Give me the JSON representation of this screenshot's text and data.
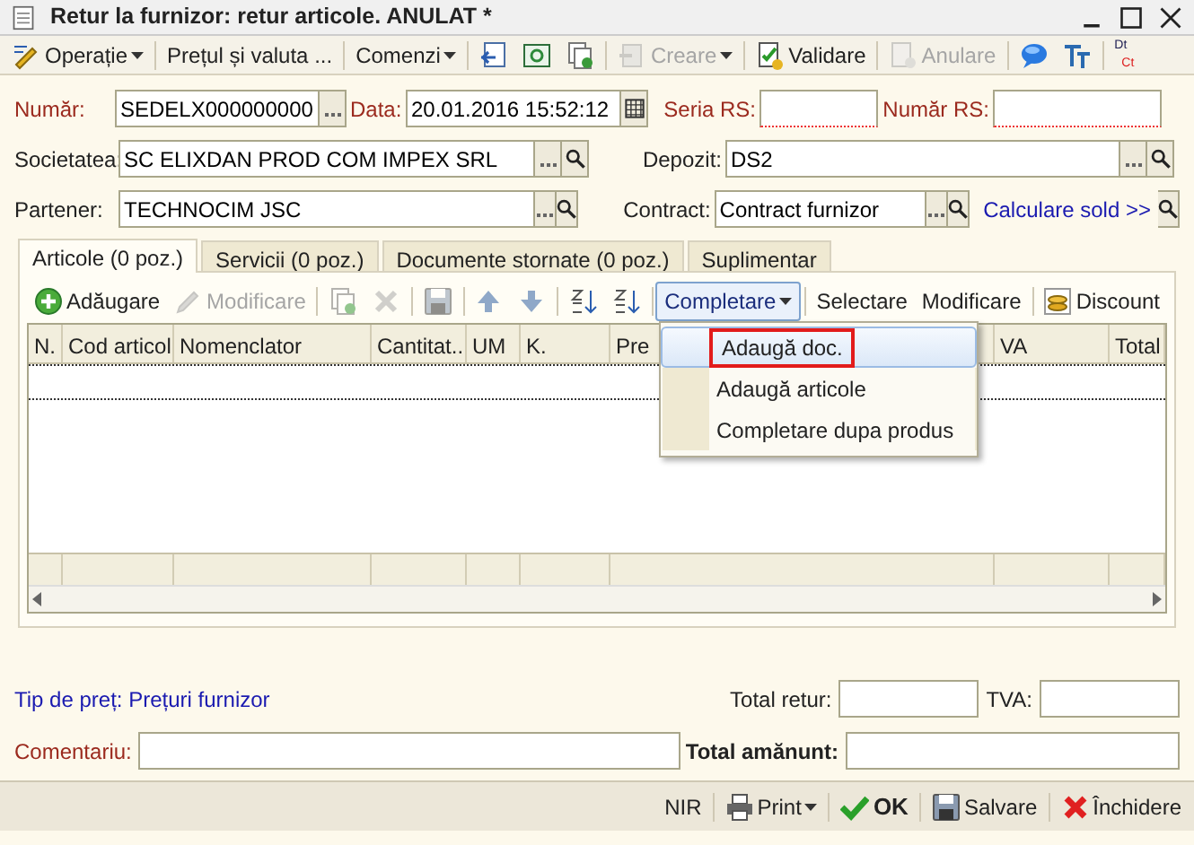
{
  "window": {
    "title": "Retur la furnizor: retur articole. ANULAT *"
  },
  "toolbar": [
    {
      "kind": "menu",
      "label": "Operație",
      "disabled": false
    },
    {
      "kind": "button",
      "label": "Prețul și valuta ...",
      "disabled": false
    },
    {
      "kind": "menu",
      "label": "Comenzi",
      "disabled": false
    },
    {
      "kind": "icon",
      "disabled": false
    },
    {
      "kind": "icon",
      "disabled": false
    },
    {
      "kind": "icon",
      "disabled": false
    },
    {
      "kind": "menu",
      "label": "Creare",
      "disabled": true
    },
    {
      "kind": "button",
      "label": "Validare",
      "disabled": false
    },
    {
      "kind": "button",
      "label": "Anulare",
      "disabled": true
    },
    {
      "kind": "icon",
      "disabled": false
    },
    {
      "kind": "icon",
      "disabled": false
    },
    {
      "kind": "dtct",
      "top": "Dt",
      "bottom": "Ct",
      "disabled": false
    }
  ],
  "header": {
    "numar": {
      "label": "Număr:",
      "value": "SEDELX000000000",
      "required": true
    },
    "data": {
      "label": "Data:",
      "value": "20.01.2016 15:52:12",
      "required": true
    },
    "seria_rs": {
      "label": "Seria RS:",
      "required": true
    },
    "numar_rs": {
      "label": "Număr RS:",
      "required": true
    },
    "societatea": {
      "label": "Societatea:",
      "value": "SC ELIXDAN PROD COM IMPEX SRL",
      "required": false
    },
    "depozit": {
      "label": "Depozit:",
      "value": "DS2",
      "required": false
    },
    "partener": {
      "label": "Partener:",
      "value": "TECHNOCIM JSC",
      "required": false
    },
    "contract": {
      "label": "Contract:",
      "value": "Contract furnizor",
      "required": false
    },
    "calculare_sold": "Calculare sold >>"
  },
  "tabs": [
    {
      "label": "Articole (0 poz.)",
      "selected": true
    },
    {
      "label": "Servicii (0 poz.)",
      "selected": false
    },
    {
      "label": "Documente stornate (0 poz.)",
      "selected": false
    },
    {
      "label": "Suplimentar",
      "selected": false
    }
  ],
  "grid_toolbar": [
    {
      "kind": "button",
      "label": "Adăugare",
      "disabled": false
    },
    {
      "kind": "button",
      "label": "Modificare",
      "disabled": true
    },
    {
      "kind": "icon",
      "disabled": true
    },
    {
      "kind": "icon",
      "disabled": true
    },
    {
      "kind": "icon",
      "disabled": true
    },
    {
      "kind": "icon",
      "disabled": false
    },
    {
      "kind": "icon",
      "disabled": false
    },
    {
      "kind": "icon",
      "disabled": false
    },
    {
      "kind": "icon",
      "disabled": false
    },
    {
      "kind": "dropdown",
      "label": "Completare",
      "disabled": false,
      "expanded": true
    },
    {
      "kind": "button",
      "label": "Selectare",
      "disabled": false
    },
    {
      "kind": "button",
      "label": "Modificare",
      "disabled": false
    },
    {
      "kind": "button",
      "label": "Discount",
      "disabled": false
    }
  ],
  "columns": [
    "N.",
    "Cod articol",
    "Nomenclator",
    "Cantitat...",
    "UM",
    "K.",
    "Pre",
    "VA",
    "Total"
  ],
  "menu": [
    {
      "label": "Adaugă doc.",
      "selected": true,
      "outlined": true
    },
    {
      "label": "Adaugă articole",
      "selected": false,
      "outlined": false
    },
    {
      "label": "Completare dupa produs",
      "selected": false,
      "outlined": false
    }
  ],
  "price_type": "Tip de preț: Prețuri furnizor",
  "total_retur": {
    "label": "Total retur:"
  },
  "tva": {
    "label": "TVA:"
  },
  "comentariu": {
    "label": "Comentariu:",
    "required": true
  },
  "total_amanunt": {
    "label": "Total amănunt:"
  },
  "footer": [
    {
      "kind": "button",
      "label": "NIR"
    },
    {
      "kind": "menu",
      "label": "Print"
    },
    {
      "kind": "default",
      "label": "OK"
    },
    {
      "kind": "button",
      "label": "Salvare"
    },
    {
      "kind": "button",
      "label": "Închidere"
    }
  ]
}
